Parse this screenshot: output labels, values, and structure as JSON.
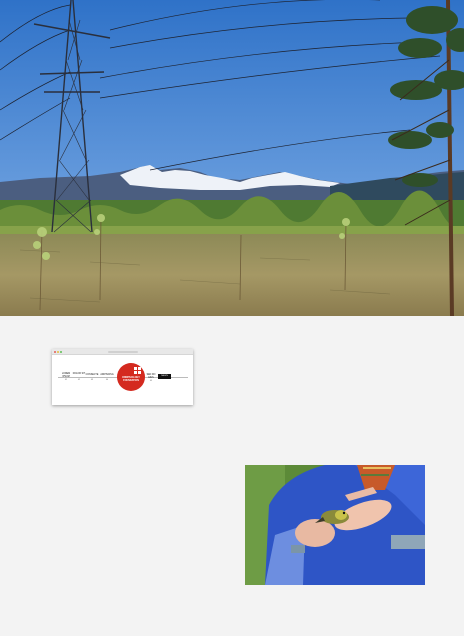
{
  "hero": {
    "alt_icon": "landscape-photo"
  },
  "browser_mock": {
    "menu": [
      {
        "label": "LOREM IPSUM",
        "num": "01"
      },
      {
        "label": "DOLOR SIT",
        "num": "02"
      },
      {
        "label": "CONSECTE",
        "num": "03"
      },
      {
        "label": "ADIPISCING",
        "num": "04"
      }
    ],
    "menu_right": [
      {
        "label": "SED DO EIUS",
        "num": "05"
      }
    ],
    "logo_text": "ORNITHOLOGY FOUNDATION",
    "logo_icon": "bird-logo-icon",
    "black_button": "NEWS",
    "colors": {
      "logo": "#d42a1f"
    }
  },
  "bird_photo": {
    "alt_icon": "bird-in-hands-photo"
  }
}
